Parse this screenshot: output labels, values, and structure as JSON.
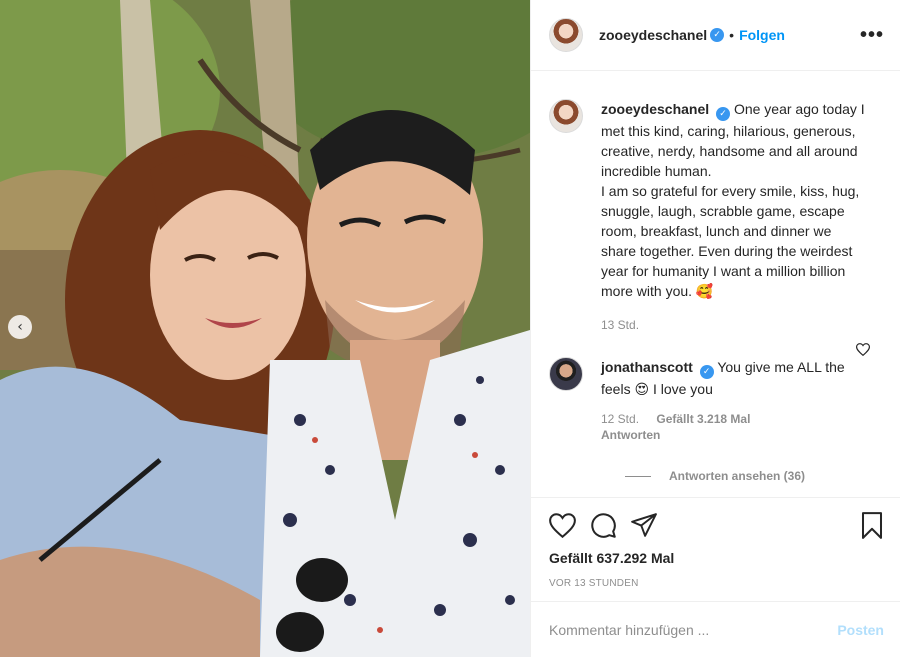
{
  "header": {
    "username": "zooeydeschanel",
    "verified_glyph": "✓",
    "separator": "•",
    "follow_label": "Folgen",
    "more_glyph": "•••"
  },
  "photo": {
    "prev_glyph": "‹",
    "description_icon": "selfie-photo"
  },
  "caption": {
    "username": "zooeydeschanel",
    "text": "One year ago today I met this kind, caring, hilarious, generous, creative, nerdy, handsome and all around incredible human.\nI am so grateful for every smile, kiss, hug, snuggle, laugh, scrabble game, escape room, breakfast, lunch and dinner we share together. Even during the weirdest year for humanity I want a million billion more with you. 🥰",
    "time": "13 Std."
  },
  "reply": {
    "username": "jonathanscott",
    "text": "You give me ALL the feels 😍 I love you",
    "time": "12 Std.",
    "likes": "Gefällt 3.218 Mal",
    "answer_label": "Antworten"
  },
  "view_replies": "Antworten ansehen (36)",
  "footer": {
    "likes": "Gefällt 637.292 Mal",
    "time": "VOR 13 STUNDEN",
    "comment_placeholder": "Kommentar hinzufügen ...",
    "post_label": "Posten"
  },
  "colors": {
    "accent": "#0095f6",
    "verified": "#3897f0",
    "muted": "#8e8e8e",
    "post_disabled": "#b2dffc"
  }
}
